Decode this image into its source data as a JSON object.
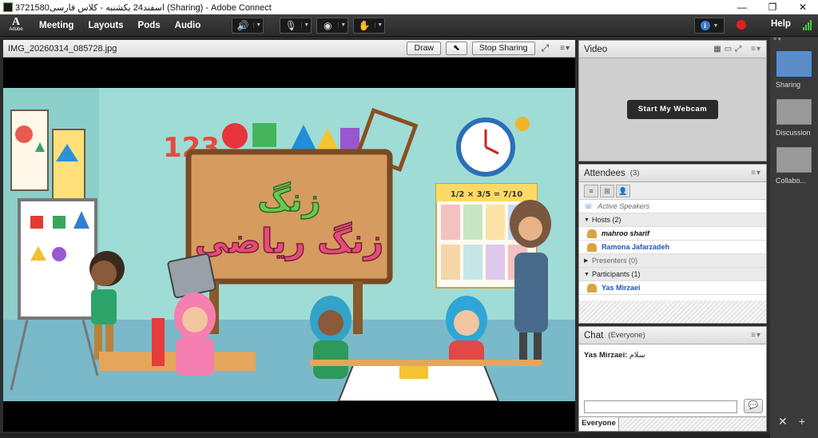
{
  "window": {
    "title": "3721580اسفند24 يكشنبه - كلاس فارسى (Sharing) - Adobe Connect",
    "minimize": "—",
    "restore": "❐",
    "close": "✕"
  },
  "menu": {
    "logo_letter": "A",
    "logo_text": "Adobe",
    "items": [
      "Meeting",
      "Layouts",
      "Pods",
      "Audio"
    ],
    "help": "Help"
  },
  "share_pod": {
    "title": "IMG_20260314_085728.jpg",
    "draw_label": "Draw",
    "stop_sharing_label": "Stop Sharing",
    "menu_icon": "≡▾"
  },
  "artwork": {
    "board_line1": "زنگ",
    "board_line2": "زنگ ریاضی",
    "chart_header": "1/2 × 3/5 = 7/10",
    "numbers": "123..."
  },
  "video_pod": {
    "title": "Video",
    "webcam_button": "Start My Webcam",
    "menu_icon": "≡▾"
  },
  "attendees_pod": {
    "title": "Attendees",
    "count": "(3)",
    "menu_icon": "≡▾",
    "active_speakers": "Active Speakers",
    "hosts_label": "Hosts (2)",
    "hosts": [
      "mahroo sharif",
      "Ramona Jafarzadeh"
    ],
    "presenters_label": "Presenters (0)",
    "participants_label": "Participants (1)",
    "participants": [
      "Yas Mirzaei"
    ]
  },
  "chat_pod": {
    "title": "Chat",
    "scope": "(Everyone)",
    "menu_icon": "≡▾",
    "messages": [
      {
        "author": "Yas Mirzaei:",
        "text": "سلام"
      }
    ],
    "tab_label": "Everyone"
  },
  "layouts": [
    {
      "label": "Sharing",
      "active": true
    },
    {
      "label": "Discussion",
      "active": false
    },
    {
      "label": "Collabo...",
      "active": false
    }
  ],
  "colors": {
    "accent_blue": "#4a90e2",
    "record_red": "#e02020",
    "audio_green": "#4cd64c"
  }
}
